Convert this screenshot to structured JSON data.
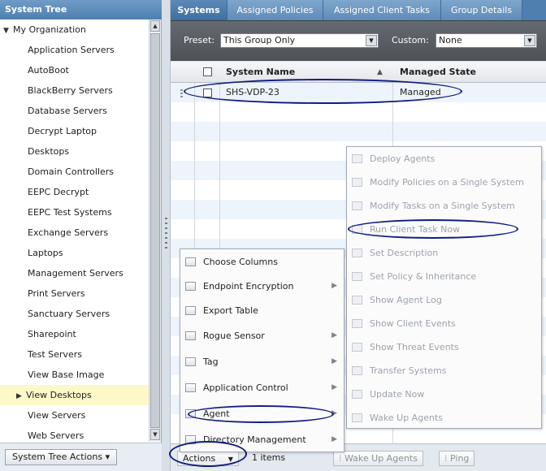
{
  "tree": {
    "header": "System Tree",
    "root": "My Organization",
    "items": [
      "Application Servers",
      "AutoBoot",
      "BlackBerry Servers",
      "Database Servers",
      "Decrypt Laptop",
      "Desktops",
      "Domain Controllers",
      "EEPC Decrypt",
      "EEPC Test Systems",
      "Exchange Servers",
      "Laptops",
      "Management Servers",
      "Print Servers",
      "Sanctuary Servers",
      "Sharepoint",
      "Test Servers",
      "View Base Image",
      "View Desktops",
      "View Servers",
      "Web Servers"
    ],
    "selected_item": "View Desktops",
    "actions_button": "System Tree Actions ▾"
  },
  "tabs": [
    "Systems",
    "Assigned Policies",
    "Assigned Client Tasks",
    "Group Details"
  ],
  "preset": {
    "preset_label": "Preset:",
    "preset_value": "This Group Only",
    "custom_label": "Custom:",
    "custom_value": "None"
  },
  "table": {
    "columns": [
      "System Name",
      "Managed State"
    ],
    "rows": [
      {
        "system_name": "SHS-VDP-23",
        "managed_state": "Managed"
      }
    ]
  },
  "actions_menu": {
    "items": [
      {
        "label": "Choose Columns",
        "submenu": false
      },
      {
        "label": "Endpoint Encryption",
        "submenu": true
      },
      {
        "label": "Export Table",
        "submenu": false
      },
      {
        "label": "Rogue Sensor",
        "submenu": true
      },
      {
        "label": "Tag",
        "submenu": true
      },
      {
        "label": "Application Control",
        "submenu": true
      },
      {
        "label": "Agent",
        "submenu": true
      },
      {
        "label": "Directory Management",
        "submenu": true
      }
    ]
  },
  "agent_submenu": {
    "items": [
      "Deploy Agents",
      "Modify Policies on a Single System",
      "Modify Tasks on a Single System",
      "Run Client Task Now",
      "Set Description",
      "Set Policy & Inheritance",
      "Show Agent Log",
      "Show Client Events",
      "Show Threat Events",
      "Transfer Systems",
      "Update Now",
      "Wake Up Agents"
    ]
  },
  "bottom_bar": {
    "actions_label": "Actions",
    "count": "1 items",
    "wake_up_agents": "Wake Up Agents",
    "ping": "Ping"
  },
  "colors": {
    "annotation": "#101c7e",
    "tab_active": "#3f6f9f",
    "selected_row": "#fdf8c8"
  }
}
